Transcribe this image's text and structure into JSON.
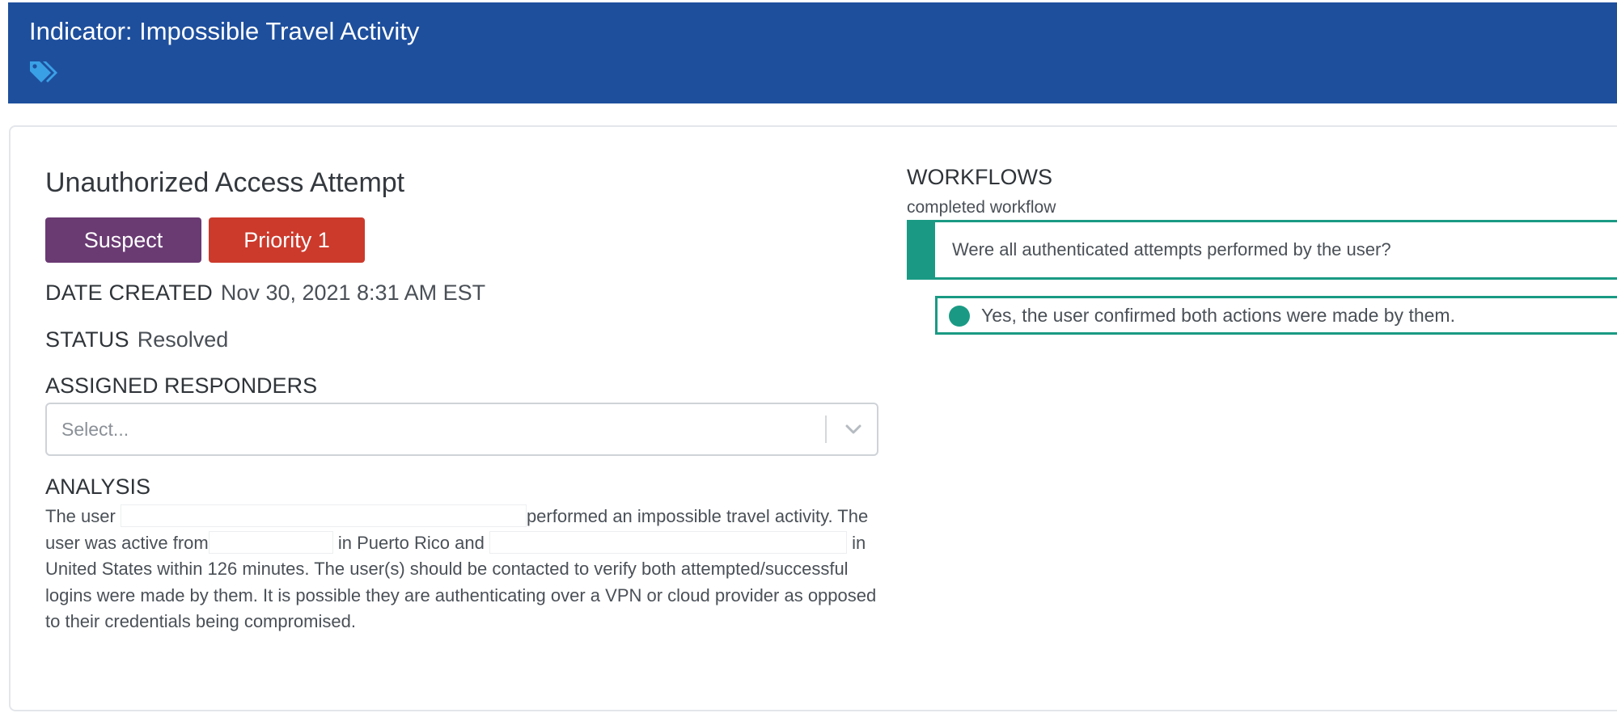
{
  "header": {
    "title": "Indicator: Impossible Travel Activity",
    "tags_icon": "tags-icon"
  },
  "incident": {
    "title": "Unauthorized Access Attempt",
    "badges": {
      "suspect": "Suspect",
      "priority": "Priority 1"
    },
    "date_created_label": "DATE CREATED",
    "date_created_value": "Nov 30, 2021 8:31 AM EST",
    "status_label": "STATUS",
    "status_value": "Resolved"
  },
  "responders": {
    "heading": "ASSIGNED RESPONDERS",
    "placeholder": "Select...",
    "chevron_icon": "chevron-down-icon"
  },
  "analysis": {
    "heading": "ANALYSIS",
    "part1": "The user ",
    "part2": "performed an impossible travel activity. The user was active from",
    "part3": " in Puerto Rico and ",
    "part4": " in United States within 126 minutes. The user(s) should be contacted to verify both attempted/successful logins were made by them. It is possible they are authenticating over a VPN or cloud provider as opposed to their credentials being compromised."
  },
  "workflows": {
    "heading": "WORKFLOWS",
    "subheading": "completed workflow",
    "question": "Were all authenticated attempts performed by the user?",
    "answer": "Yes, the user confirmed both actions were made by them."
  },
  "colors": {
    "header_bg": "#1e4f9d",
    "suspect_badge": "#6a3a73",
    "priority_badge": "#cc3a2c",
    "workflow_accent": "#1a9a84",
    "tag_icon": "#3aa0e6"
  }
}
